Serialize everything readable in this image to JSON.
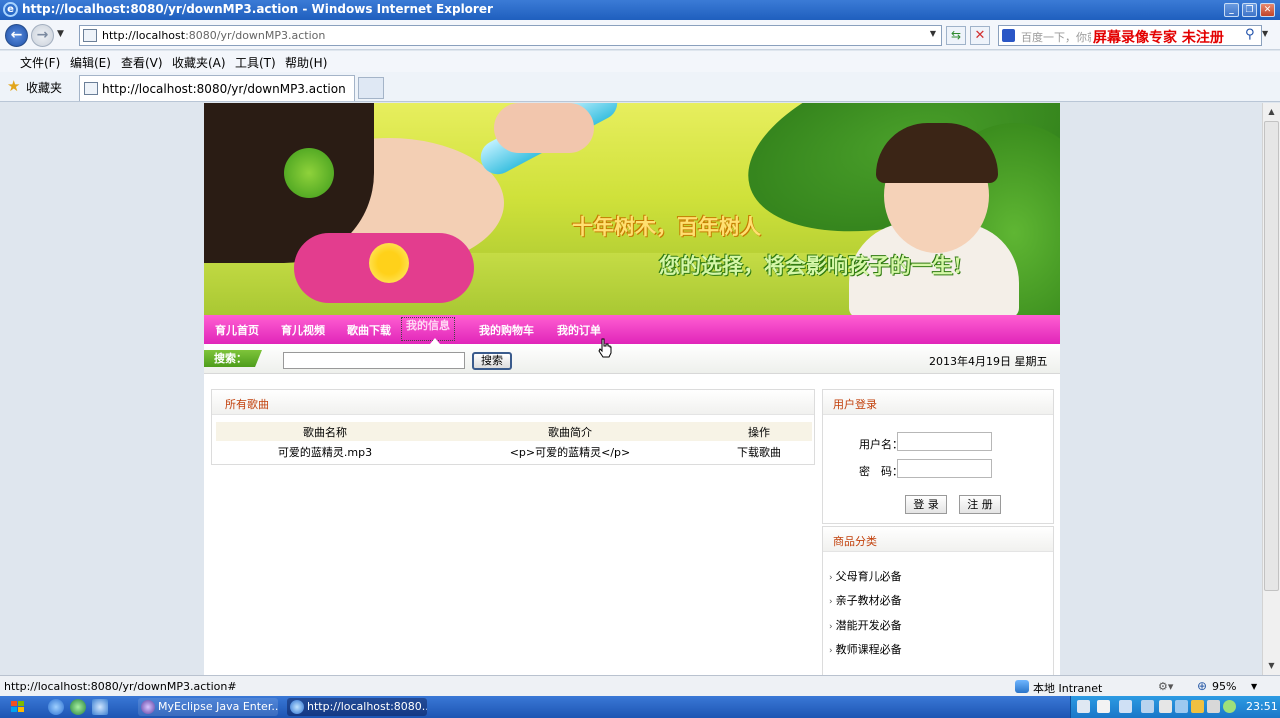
{
  "browser": {
    "window_title": "http://localhost:8080/yr/downMP3.action - Windows Internet Explorer",
    "address_host": "http://localhost",
    "address_path": ":8080/yr/downMP3.action",
    "search_placeholder": "百度一下，你就知道",
    "watermark": "屏幕录像专家  未注册",
    "menu": [
      "文件(F)",
      "编辑(E)",
      "查看(V)",
      "收藏夹(A)",
      "工具(T)",
      "帮助(H)"
    ],
    "favorites_label": "收藏夹",
    "tab_title": "http://localhost:8080/yr/downMP3.action",
    "status_text": "http://localhost:8080/yr/downMP3.action#",
    "zone": "本地 Intranet",
    "zoom": "95%"
  },
  "page": {
    "banner": {
      "slogan1": "十年树木，百年树人",
      "slogan2": "您的选择，将会影响孩子的一生!"
    },
    "nav": [
      "育儿首页",
      "育儿视频",
      "歌曲下载",
      "我的信息",
      "我的购物车",
      "我的订单"
    ],
    "active_nav": "我的信息",
    "search": {
      "label": "搜索：",
      "button": "搜索",
      "date": "2013年4月19日 星期五"
    },
    "songs": {
      "title": "所有歌曲",
      "columns": [
        "歌曲名称",
        "歌曲简介",
        "操作"
      ],
      "rows": [
        {
          "name": "可爱的蓝精灵.mp3",
          "intro": "<p>可爱的蓝精灵</p>",
          "action": "下载歌曲"
        }
      ]
    },
    "login": {
      "title": "用户登录",
      "username_label": "用户名：",
      "password_label": "密　码：",
      "login_button": "登 录",
      "register_button": "注 册"
    },
    "categories": {
      "title": "商品分类",
      "items": [
        "父母育儿必备",
        "亲子教材必备",
        "潜能开发必备",
        "教师课程必备"
      ]
    }
  },
  "taskbar": {
    "tasks": [
      "MyEclipse Java Enter...",
      "http://localhost:8080..."
    ],
    "clock": "23:51"
  },
  "colors": {
    "nav_pink": "#e025b9",
    "title_bar_blue": "#2a6bcf",
    "panel_title_orange": "#c2410c",
    "search_tag_green": "#5aa624"
  }
}
